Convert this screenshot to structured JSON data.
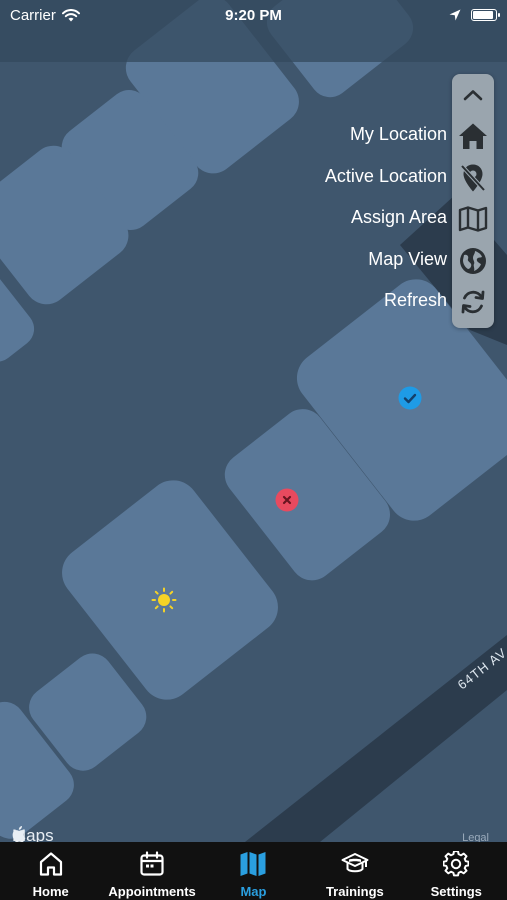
{
  "status_bar": {
    "carrier": "Carrier",
    "time": "9:20 PM",
    "battery_level": 0.9
  },
  "map": {
    "street_label": "64TH AV",
    "attribution": "Maps",
    "legal": "Legal",
    "markers": [
      {
        "type": "completed",
        "icon": "check-icon",
        "color": "#1e9be6"
      },
      {
        "type": "rejected",
        "icon": "x-icon",
        "color": "#e84a5f"
      },
      {
        "type": "current",
        "icon": "sun-icon",
        "color": "#f5d327"
      }
    ]
  },
  "menu": {
    "collapse_icon": "chevron-up-icon",
    "items": [
      {
        "label": "My Location",
        "icon": "home-icon"
      },
      {
        "label": "Active Location",
        "icon": "location-off-icon"
      },
      {
        "label": "Assign Area",
        "icon": "map-icon"
      },
      {
        "label": "Map View",
        "icon": "globe-icon"
      },
      {
        "label": "Refresh",
        "icon": "refresh-icon"
      }
    ]
  },
  "tabs": [
    {
      "label": "Home",
      "icon": "home-icon",
      "active": false
    },
    {
      "label": "Appointments",
      "icon": "calendar-icon",
      "active": false
    },
    {
      "label": "Map",
      "icon": "map-icon",
      "active": true
    },
    {
      "label": "Trainings",
      "icon": "graduation-cap-icon",
      "active": false
    },
    {
      "label": "Settings",
      "icon": "gear-icon",
      "active": false
    }
  ],
  "colors": {
    "map_background": "#3f566d",
    "building": "#5a7898",
    "road": "#2c3c4d",
    "tab_active": "#2a9fe0",
    "tab_bar": "#111111"
  }
}
